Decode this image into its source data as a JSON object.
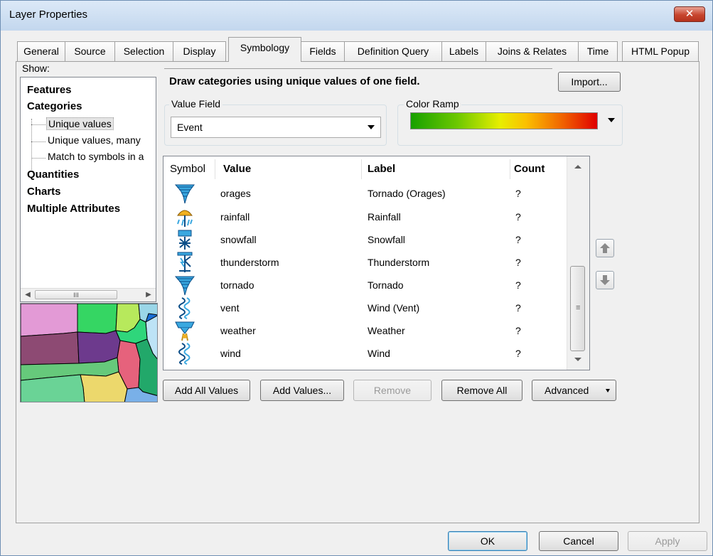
{
  "window": {
    "title": "Layer Properties",
    "close_glyph": "✕"
  },
  "tabs": [
    "General",
    "Source",
    "Selection",
    "Display",
    "Symbology",
    "Fields",
    "Definition Query",
    "Labels",
    "Joins & Relates",
    "Time",
    "HTML Popup"
  ],
  "active_tab": "Symbology",
  "show": {
    "label": "Show:",
    "categories": [
      "Features",
      "Categories",
      "Quantities",
      "Charts",
      "Multiple Attributes"
    ],
    "sub_items": [
      "Unique values",
      "Unique values, many",
      "Match to symbols in a"
    ],
    "selected_sub_item": "Unique values",
    "scroll_grip": "III"
  },
  "description": "Draw categories using unique values of one field.",
  "import_button": "Import...",
  "value_field": {
    "legend": "Value Field",
    "value": "Event"
  },
  "color_ramp": {
    "legend": "Color Ramp",
    "colors": [
      "#17a000",
      "#6dc800",
      "#e8ee00",
      "#fbbf00",
      "#f06000",
      "#e00000"
    ]
  },
  "table": {
    "headers": {
      "symbol": "Symbol",
      "value": "Value",
      "label": "Label",
      "count": "Count"
    },
    "rows": [
      {
        "icon": "tornado-icon",
        "value": "orages",
        "label": "Tornado (Orages)",
        "count": "?"
      },
      {
        "icon": "rainfall-icon",
        "value": "rainfall",
        "label": "Rainfall",
        "count": "?"
      },
      {
        "icon": "snowfall-icon",
        "value": "snowfall",
        "label": "Snowfall",
        "count": "?"
      },
      {
        "icon": "thunderstorm-icon",
        "value": "thunderstorm",
        "label": "Thunderstorm",
        "count": "?"
      },
      {
        "icon": "tornado-icon",
        "value": "tornado",
        "label": "Tornado",
        "count": "?"
      },
      {
        "icon": "wind-icon",
        "value": "vent",
        "label": "Wind (Vent)",
        "count": "?"
      },
      {
        "icon": "weather-icon",
        "value": "weather",
        "label": "Weather",
        "count": "?"
      },
      {
        "icon": "wind-icon",
        "value": "wind",
        "label": "Wind",
        "count": "?"
      }
    ],
    "grip_glyph": "≡"
  },
  "buttons": {
    "add_all": "Add All Values",
    "add_values": "Add Values...",
    "remove": "Remove",
    "remove_all": "Remove All",
    "advanced": "Advanced",
    "ok": "OK",
    "cancel": "Cancel",
    "apply": "Apply"
  }
}
